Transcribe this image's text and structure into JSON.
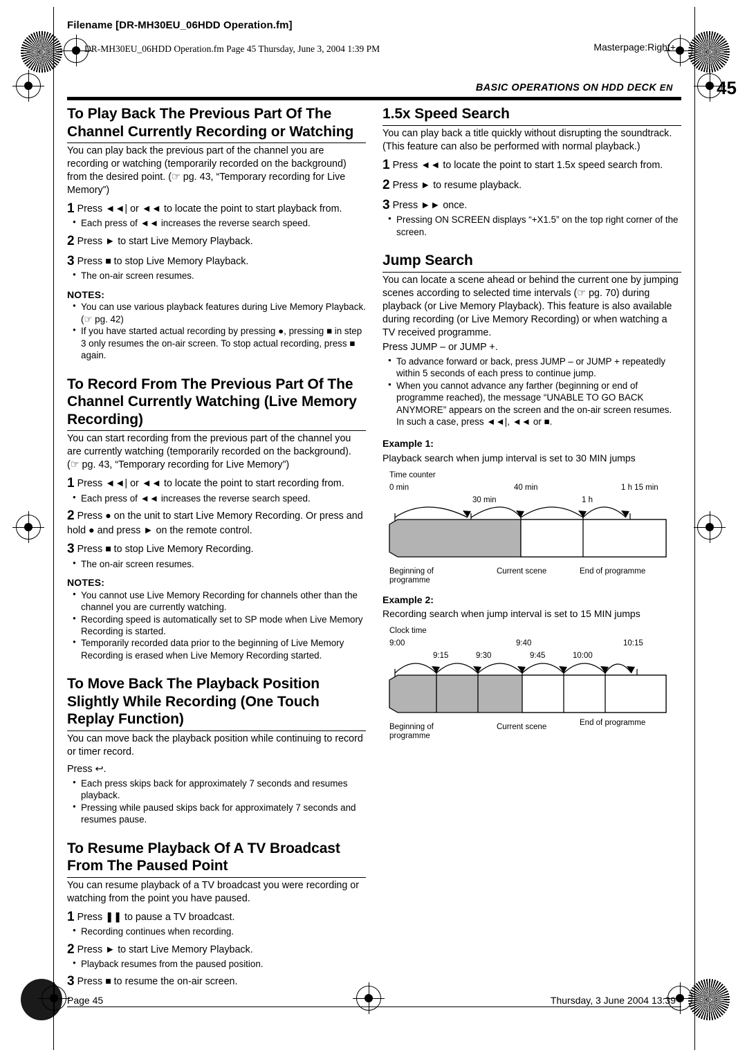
{
  "header": {
    "filename": "Filename [DR-MH30EU_06HDD Operation.fm]",
    "fmline": "DR-MH30EU_06HDD Operation.fm  Page 45  Thursday, June 3, 2004  1:39 PM",
    "masterpage": "Masterpage:Right+",
    "running_head": "BASIC OPERATIONS ON HDD DECK",
    "en_label": "EN",
    "page_number": "45"
  },
  "left": {
    "s1": {
      "title": "To Play Back The Previous Part Of The Channel Currently Recording or Watching",
      "body": "You can play back the previous part of the channel you are recording or watching (temporarily recorded on the background) from the desired point. (☞ pg. 43, “Temporary recording for Live Memory”)",
      "step1": "Press ◄◄| or ◄◄ to locate the point to start playback from.",
      "step1b": "Each press of ◄◄ increases the reverse search speed.",
      "step2": "Press ► to start Live Memory Playback.",
      "step3": "Press ■ to stop Live Memory Playback.",
      "step3b": "The on-air screen resumes.",
      "notes_label": "NOTES:",
      "note1": "You can use various playback features during Live Memory Playback. (☞ pg. 42)",
      "note2": "If you have started actual recording by pressing ●, pressing ■ in step 3 only resumes the on-air screen. To stop actual recording, press ■ again."
    },
    "s2": {
      "title": "To Record From The Previous Part Of The Channel Currently Watching (Live Memory Recording)",
      "body": "You can start recording from the previous part of the channel you are currently watching (temporarily recorded on the background). (☞ pg. 43, “Temporary recording for Live Memory”)",
      "step1": "Press ◄◄| or ◄◄ to locate the point to start recording from.",
      "step1b": "Each press of ◄◄ increases the reverse search speed.",
      "step2": "Press ● on the unit to start Live Memory Recording. Or press and hold ● and press ► on the remote control.",
      "step3": "Press ■ to stop Live Memory Recording.",
      "step3b": "The on-air screen resumes.",
      "notes_label": "NOTES:",
      "note1": "You cannot use Live Memory Recording for channels other than the channel you are currently watching.",
      "note2": "Recording speed is automatically set to SP mode when Live Memory Recording is started.",
      "note3": "Temporarily recorded data prior to the beginning of Live Memory Recording is erased when Live Memory Recording started."
    },
    "s3": {
      "title": "To Move Back The Playback Position Slightly While Recording (One Touch Replay Function)",
      "body": "You can move back the playback position while continuing to record or timer record.",
      "press": "Press ↩.",
      "bul1": "Each press skips back for approximately 7 seconds and resumes playback.",
      "bul2": "Pressing while paused skips back for approximately 7 seconds and resumes pause."
    },
    "s4": {
      "title": "To Resume Playback Of A TV Broadcast From The Paused Point",
      "body": "You can resume playback of a TV broadcast you were recording or watching from the point you have paused.",
      "step1": "Press ❚❚ to pause a TV broadcast.",
      "step1b": "Recording continues when recording.",
      "step2": "Press ► to start Live Memory Playback.",
      "step2b": "Playback resumes from the paused position.",
      "step3": "Press ■ to resume the on-air screen."
    }
  },
  "right": {
    "s1": {
      "title": "1.5x Speed Search",
      "body": "You can play back a title quickly without disrupting the soundtrack. (This feature can also be performed with normal playback.)",
      "step1": "Press ◄◄ to locate the point to start 1.5x speed search from.",
      "step2": "Press ► to resume playback.",
      "step3": "Press ►► once.",
      "bul1": "Pressing ON SCREEN displays “+X1.5” on the top right corner of the screen.",
      "bul1_bold": "ON SCREEN"
    },
    "s2": {
      "title": "Jump Search",
      "body": "You can locate a scene ahead or behind the current one by jumping scenes according to selected time intervals (☞ pg. 70) during playback (or Live Memory Playback). This feature is also available during recording (or Live Memory Recording) or when watching a TV received programme.",
      "press": "Press JUMP – or JUMP +.",
      "press_bold": "JUMP – or JUMP +",
      "bul1": "To advance forward or back, press JUMP – or JUMP + repeatedly within 5 seconds of each press to continue jump.",
      "bul2": "When you cannot advance any farther (beginning or end of programme reached), the message “UNABLE TO GO BACK ANYMORE” appears on the screen and the on-air screen resumes. In such a case, press ◄◄|, ◄◄ or ■."
    },
    "example1": {
      "label": "Example 1:",
      "caption": "Playback search when jump interval is set to 30 MIN jumps",
      "axis_title": "Time counter",
      "ticks_upper": [
        "0 min",
        "40 min",
        "1 h 15 min"
      ],
      "ticks_lower": [
        "30 min",
        "1 h"
      ],
      "note_left": "Beginning of programme",
      "note_mid": "Current scene",
      "note_right": "End of programme"
    },
    "example2": {
      "label": "Example 2:",
      "caption": "Recording search when jump interval is set to 15 MIN jumps",
      "axis_title": "Clock time",
      "ticks_upper": [
        "9:00",
        "9:40",
        "10:15"
      ],
      "ticks_lower": [
        "9:15",
        "9:30",
        "9:45",
        "10:00"
      ],
      "note_left": "Beginning of programme",
      "note_mid": "Current scene",
      "note_right": "End of programme"
    }
  },
  "footer": {
    "left": "Page 45",
    "right": "Thursday, 3 June 2004  13:39"
  }
}
